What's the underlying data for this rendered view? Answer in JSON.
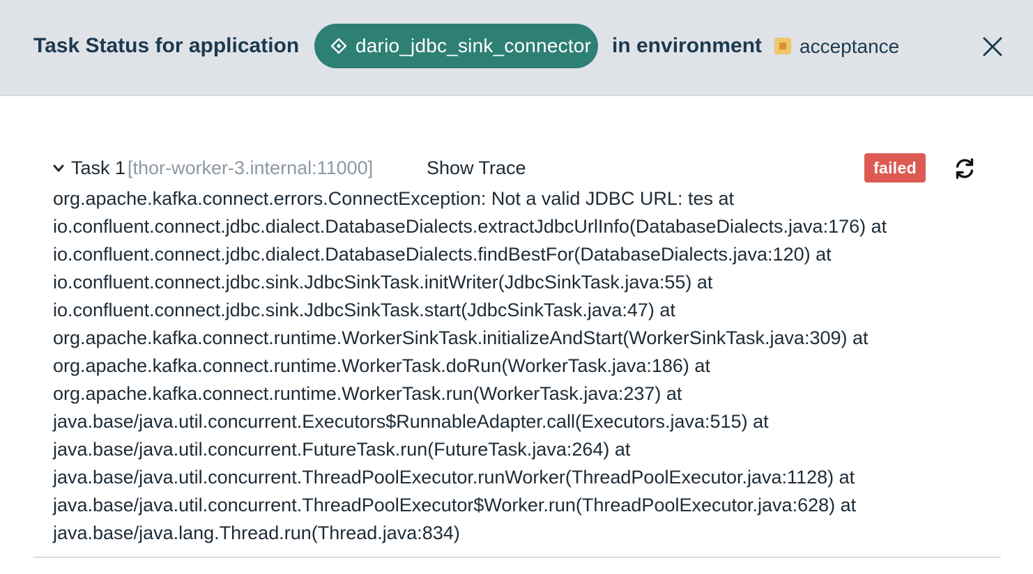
{
  "header": {
    "title": "Task Status for application",
    "application": {
      "name": "dario_jdbc_sink_connector",
      "icon": "diamond-app-icon",
      "color": "#2e7f74"
    },
    "env_prefix": "in environment",
    "environment": {
      "name": "acceptance",
      "icon": "environment-square-icon",
      "color": "#f0c56b"
    },
    "close_icon": "close-icon"
  },
  "task": {
    "label": "Task 1",
    "host": "[thor-worker-3.internal:11000]",
    "show_trace_label": "Show Trace",
    "status": "failed",
    "status_color": "#dd5a52",
    "expand_icon": "chevron-down-icon",
    "refresh_icon": "refresh-icon",
    "trace_lines": [
      "org.apache.kafka.connect.errors.ConnectException: Not a valid JDBC URL: tes at",
      "io.confluent.connect.jdbc.dialect.DatabaseDialects.extractJdbcUrlInfo(DatabaseDialects.java:176) at",
      "io.confluent.connect.jdbc.dialect.DatabaseDialects.findBestFor(DatabaseDialects.java:120) at",
      "io.confluent.connect.jdbc.sink.JdbcSinkTask.initWriter(JdbcSinkTask.java:55) at",
      "io.confluent.connect.jdbc.sink.JdbcSinkTask.start(JdbcSinkTask.java:47) at",
      "org.apache.kafka.connect.runtime.WorkerSinkTask.initializeAndStart(WorkerSinkTask.java:309) at",
      "org.apache.kafka.connect.runtime.WorkerTask.doRun(WorkerTask.java:186) at",
      "org.apache.kafka.connect.runtime.WorkerTask.run(WorkerTask.java:237) at",
      "java.base/java.util.concurrent.Executors$RunnableAdapter.call(Executors.java:515) at",
      "java.base/java.util.concurrent.FutureTask.run(FutureTask.java:264) at",
      "java.base/java.util.concurrent.ThreadPoolExecutor.runWorker(ThreadPoolExecutor.java:1128) at",
      "java.base/java.util.concurrent.ThreadPoolExecutor$Worker.run(ThreadPoolExecutor.java:628) at",
      "java.base/java.lang.Thread.run(Thread.java:834)"
    ]
  }
}
